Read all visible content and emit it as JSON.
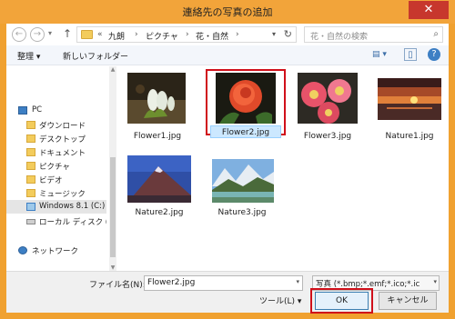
{
  "window": {
    "title": "連絡先の写真の追加",
    "close_glyph": "✕"
  },
  "nav_buttons": {
    "back_glyph": "←",
    "forward_glyph": "→",
    "recent_glyph": "▾",
    "up_glyph": "↑"
  },
  "address": {
    "overflow": "«",
    "crumbs": [
      "九朗",
      "ピクチャ",
      "花・自然"
    ],
    "separator": "›",
    "dropdown_glyph": "▾",
    "refresh_glyph": "↻"
  },
  "search": {
    "placeholder": "花・自然の検索",
    "icon_glyph": "⌕"
  },
  "toolbar": {
    "organize_label": "整理 ▾",
    "new_folder_label": "新しいフォルダー",
    "view_glyph": "▤ ▾",
    "preview_glyph": "▯",
    "help_glyph": "?"
  },
  "nav_pane": {
    "up_glyph": "▲",
    "down_glyph": "▼",
    "items": [
      {
        "label": "PC",
        "icon": "pc-icon"
      },
      {
        "label": "ダウンロード",
        "icon": "download-folder-icon"
      },
      {
        "label": "デスクトップ",
        "icon": "desktop-folder-icon"
      },
      {
        "label": "ドキュメント",
        "icon": "documents-folder-icon"
      },
      {
        "label": "ピクチャ",
        "icon": "pictures-folder-icon"
      },
      {
        "label": "ビデオ",
        "icon": "video-folder-icon"
      },
      {
        "label": "ミュージック",
        "icon": "music-folder-icon"
      },
      {
        "label": "Windows 8.1 (C:)",
        "icon": "windows-drive-icon"
      },
      {
        "label": "ローカル ディスク (D:)",
        "icon": "local-disk-icon"
      },
      {
        "label": "ネットワーク",
        "icon": "network-icon"
      }
    ]
  },
  "files": [
    {
      "name": "Flower1.jpg",
      "icon": "photo-flower1"
    },
    {
      "name": "Flower2.jpg",
      "icon": "photo-flower2",
      "selected": true
    },
    {
      "name": "Flower3.jpg",
      "icon": "photo-flower3"
    },
    {
      "name": "Nature1.jpg",
      "icon": "photo-nature1"
    },
    {
      "name": "Nature2.jpg",
      "icon": "photo-nature2"
    },
    {
      "name": "Nature3.jpg",
      "icon": "photo-nature3"
    }
  ],
  "bottom": {
    "filename_label": "ファイル名(N):",
    "filename_value": "Flower2.jpg",
    "filename_drop": "▾",
    "filetype_value": "写真 (*.bmp;*.emf;*.ico;*.ic",
    "filetype_drop": "▾",
    "tools_label": "ツール(L)  ▾",
    "ok_label": "OK",
    "cancel_label": "キャンセル"
  },
  "colors": {
    "titlebar": "#f2a43a",
    "highlight": "#d0101a",
    "close": "#c7372d"
  }
}
